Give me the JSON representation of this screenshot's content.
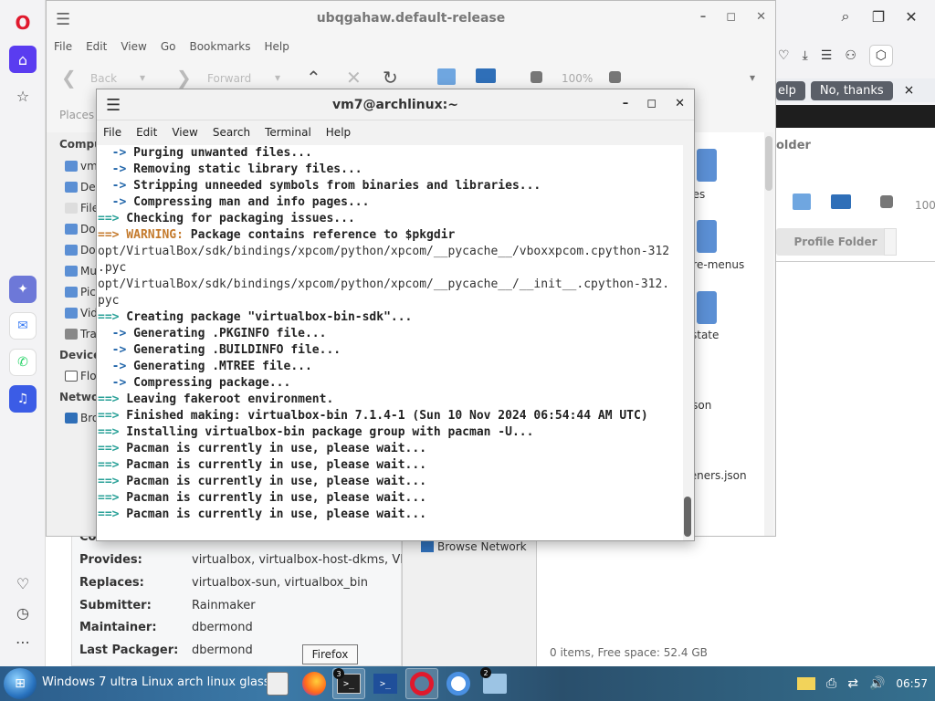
{
  "opera": {
    "logo": "O",
    "banner_help": "elp",
    "banner_no_thanks": "No, thanks",
    "banner_close": "×",
    "folder_title": "older",
    "profile_folder": "Profile Folder",
    "zoom": "100"
  },
  "file_manager": {
    "title": "ubqgahaw.default-release",
    "menu": [
      "File",
      "Edit",
      "View",
      "Go",
      "Bookmarks",
      "Help"
    ],
    "back_label": "Back",
    "forward_label": "Forward",
    "zoom": "100%",
    "places_label": "Places",
    "sidebar": {
      "computer_header": "Compu",
      "items": [
        "vm",
        "De",
        "File",
        "Do",
        "Do",
        "Mu",
        "Pic",
        "Vid",
        "Tra"
      ],
      "devices_header": "Device",
      "device_items": [
        "Flo"
      ],
      "network_header": "Netwo",
      "network_items": [
        "Bro"
      ]
    },
    "files": [
      "nes",
      "ore-menus",
      "_state",
      ".json",
      "teners.json"
    ],
    "browse_network": "Browse Network",
    "status": "0 items, Free space: 52.4 GB"
  },
  "package_info": {
    "rows": [
      {
        "key": "Provides:",
        "value": "virtualbox, virtualbox-host-dkms, VIRT"
      },
      {
        "key": "Replaces:",
        "value": "virtualbox-sun, virtualbox_bin"
      },
      {
        "key": "Submitter:",
        "value": "Rainmaker"
      },
      {
        "key": "Maintainer:",
        "value": "dbermond"
      },
      {
        "key": "Last Packager:",
        "value": "dbermond"
      }
    ],
    "partial_key": "Co"
  },
  "terminal": {
    "title": "vm7@archlinux:~",
    "menu": [
      "File",
      "Edit",
      "View",
      "Search",
      "Terminal",
      "Help"
    ],
    "lines": [
      {
        "prefix": "  ->",
        "type": "sub",
        "text": " Purging unwanted files..."
      },
      {
        "prefix": "  ->",
        "type": "sub",
        "text": " Removing static library files..."
      },
      {
        "prefix": "  ->",
        "type": "sub",
        "text": " Stripping unneeded symbols from binaries and libraries..."
      },
      {
        "prefix": "  ->",
        "type": "sub",
        "text": " Compressing man and info pages..."
      },
      {
        "prefix": "==>",
        "type": "main",
        "text": " Checking for packaging issues..."
      },
      {
        "prefix": "==>",
        "type": "warn",
        "warn": " WARNING:",
        "text": " Package contains reference to $pkgdir"
      },
      {
        "prefix": "",
        "type": "path",
        "text": "opt/VirtualBox/sdk/bindings/xpcom/python/xpcom/__pycache__/vboxxpcom.cpython-312"
      },
      {
        "prefix": "",
        "type": "path",
        "text": ".pyc"
      },
      {
        "prefix": "",
        "type": "path",
        "text": "opt/VirtualBox/sdk/bindings/xpcom/python/xpcom/__pycache__/__init__.cpython-312."
      },
      {
        "prefix": "",
        "type": "path",
        "text": "pyc"
      },
      {
        "prefix": "==>",
        "type": "main",
        "text": " Creating package \"virtualbox-bin-sdk\"..."
      },
      {
        "prefix": "  ->",
        "type": "sub",
        "text": " Generating .PKGINFO file..."
      },
      {
        "prefix": "  ->",
        "type": "sub",
        "text": " Generating .BUILDINFO file..."
      },
      {
        "prefix": "  ->",
        "type": "sub",
        "text": " Generating .MTREE file..."
      },
      {
        "prefix": "  ->",
        "type": "sub",
        "text": " Compressing package..."
      },
      {
        "prefix": "==>",
        "type": "main",
        "text": " Leaving fakeroot environment."
      },
      {
        "prefix": "==>",
        "type": "main",
        "text": " Finished making: virtualbox-bin 7.1.4-1 (Sun 10 Nov 2024 06:54:44 AM UTC)"
      },
      {
        "prefix": "==>",
        "type": "main",
        "text": " Installing virtualbox-bin package group with pacman -U..."
      },
      {
        "prefix": "==>",
        "type": "main",
        "text": " Pacman is currently in use, please wait..."
      },
      {
        "prefix": "==>",
        "type": "main",
        "text": " Pacman is currently in use, please wait..."
      },
      {
        "prefix": "==>",
        "type": "main",
        "text": " Pacman is currently in use, please wait..."
      },
      {
        "prefix": "==>",
        "type": "main",
        "text": " Pacman is currently in use, please wait..."
      },
      {
        "prefix": "==>",
        "type": "main",
        "text": " Pacman is currently in use, please wait..."
      }
    ]
  },
  "tooltip": "Firefox",
  "taskbar": {
    "start_label": "Windows 7 ultra Linux arch linux glass",
    "terminal_badge": "3",
    "chrome_badge": "2",
    "clock": "06:57"
  },
  "colors": {
    "opera_red": "#e0192d",
    "opera_home": "#5a3cf0",
    "term_arrow": "#2aa198",
    "term_warning": "#c47a2c"
  }
}
